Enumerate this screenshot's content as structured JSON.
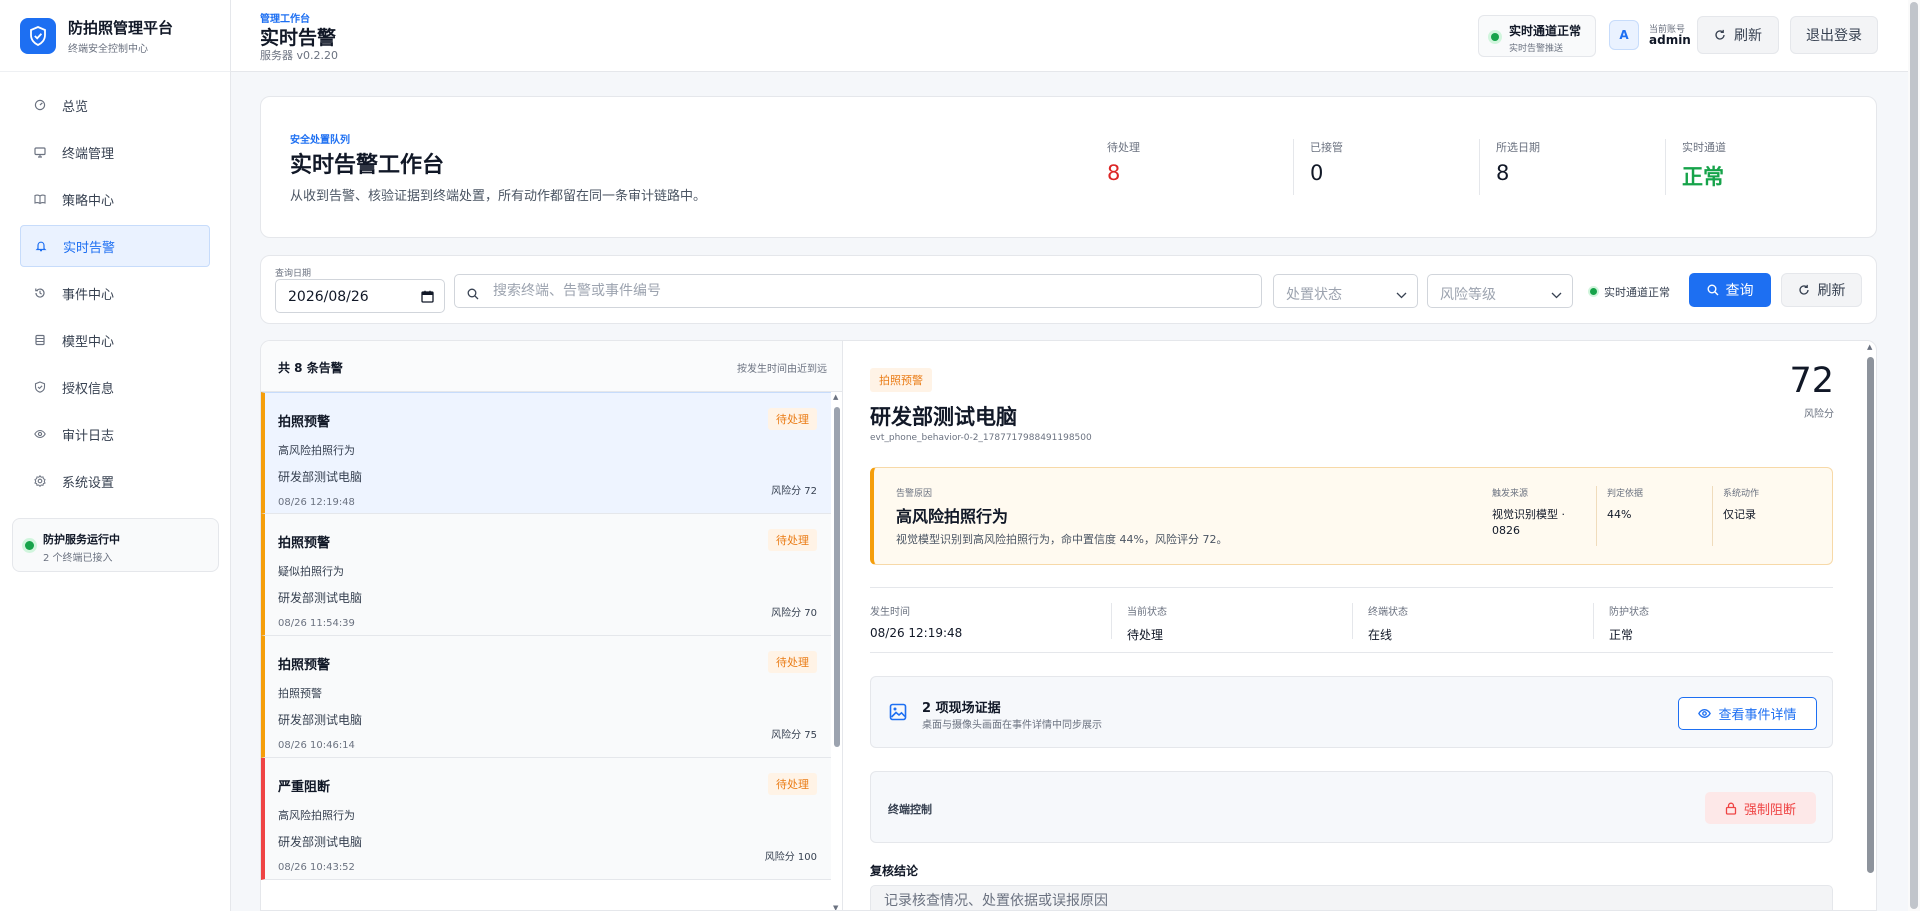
{
  "brand": {
    "title": "防拍照管理平台",
    "subtitle": "终端安全控制中心"
  },
  "sidebar": {
    "items": [
      {
        "label": "总览",
        "icon": "dashboard-icon"
      },
      {
        "label": "终端管理",
        "icon": "monitor-icon"
      },
      {
        "label": "策略中心",
        "icon": "book-icon"
      },
      {
        "label": "实时告警",
        "icon": "bell-icon",
        "active": true
      },
      {
        "label": "事件中心",
        "icon": "history-icon"
      },
      {
        "label": "模型中心",
        "icon": "database-icon"
      },
      {
        "label": "授权信息",
        "icon": "shield-check-icon"
      },
      {
        "label": "审计日志",
        "icon": "eye-icon"
      },
      {
        "label": "系统设置",
        "icon": "gear-icon"
      }
    ],
    "service": {
      "title": "防护服务运行中",
      "subtitle": "2 个终端已接入"
    }
  },
  "topbar": {
    "breadcrumb": "管理工作台",
    "title": "实时告警",
    "server_version": "服务器 v0.2.20",
    "realtime": {
      "title": "实时通道正常",
      "subtitle": "实时告警推送"
    },
    "avatar_letter": "A",
    "account_label": "当前账号",
    "account_name": "admin",
    "refresh_label": "刷新",
    "logout_label": "退出登录"
  },
  "summary": {
    "kicker": "安全处置队列",
    "title": "实时告警工作台",
    "description": "从收到告警、核验证据到终端处置，所有动作都留在同一条审计链路中。",
    "stats": [
      {
        "label": "待处理",
        "value": "8"
      },
      {
        "label": "已接管",
        "value": "0"
      },
      {
        "label": "所选日期",
        "value": "8"
      },
      {
        "label": "实时通道",
        "value": "正常"
      }
    ]
  },
  "filters": {
    "date_label": "查询日期",
    "date_value": "2026/08/26",
    "search_placeholder": "搜索终端、告警或事件编号",
    "status_placeholder": "处置状态",
    "risk_placeholder": "风险等级",
    "channel_status": "实时通道正常",
    "query_label": "查询",
    "refresh_label": "刷新"
  },
  "alert_list": {
    "count_text": "共 8 条告警",
    "sort_text": "按发生时间由近到远",
    "items": [
      {
        "type": "拍照预警",
        "status": "待处理",
        "reason": "高风险拍照行为",
        "device": "研发部测试电脑",
        "time": "08/26 12:19:48",
        "risk": "风险分 72"
      },
      {
        "type": "拍照预警",
        "status": "待处理",
        "reason": "疑似拍照行为",
        "device": "研发部测试电脑",
        "time": "08/26 11:54:39",
        "risk": "风险分 70"
      },
      {
        "type": "拍照预警",
        "status": "待处理",
        "reason": "拍照预警",
        "device": "研发部测试电脑",
        "time": "08/26 10:46:14",
        "risk": "风险分 75"
      },
      {
        "type": "严重阻断",
        "status": "待处理",
        "reason": "高风险拍照行为",
        "device": "研发部测试电脑",
        "time": "08/26 10:43:52",
        "risk": "风险分 100"
      }
    ]
  },
  "detail": {
    "badge": "拍照预警",
    "title": "研发部测试电脑",
    "event_id": "evt_phone_behavior-0-2_1787717988491198500",
    "score": "72",
    "score_label": "风险分",
    "reason": {
      "label": "告警原因",
      "title": "高风险拍照行为",
      "description": "视觉模型识别到高风险拍照行为，命中置信度 44%，风险评分 72。",
      "source_label": "触发来源",
      "source_value": "视觉识别模型 · 0826",
      "basis_label": "判定依据",
      "basis_value": "44%",
      "action_label": "系统动作",
      "action_value": "仅记录"
    },
    "meta": [
      {
        "label": "发生时间",
        "value": "08/26 12:19:48"
      },
      {
        "label": "当前状态",
        "value": "待处理"
      },
      {
        "label": "终端状态",
        "value": "在线"
      },
      {
        "label": "防护状态",
        "value": "正常"
      }
    ],
    "evidence": {
      "title": "2 项现场证据",
      "subtitle": "桌面与摄像头画面在事件详情中同步展示",
      "button": "查看事件详情"
    },
    "terminal_control": {
      "label": "终端控制",
      "button": "强制阻断"
    },
    "review": {
      "label": "复核结论",
      "placeholder": "记录核查情况、处置依据或误报原因"
    }
  },
  "colors": {
    "accent": "#1d6ff2",
    "pending_red": "#dc2626",
    "normal_green": "#16a34a",
    "warning_orange": "#ea7c16",
    "severe_red": "#ef4444"
  }
}
